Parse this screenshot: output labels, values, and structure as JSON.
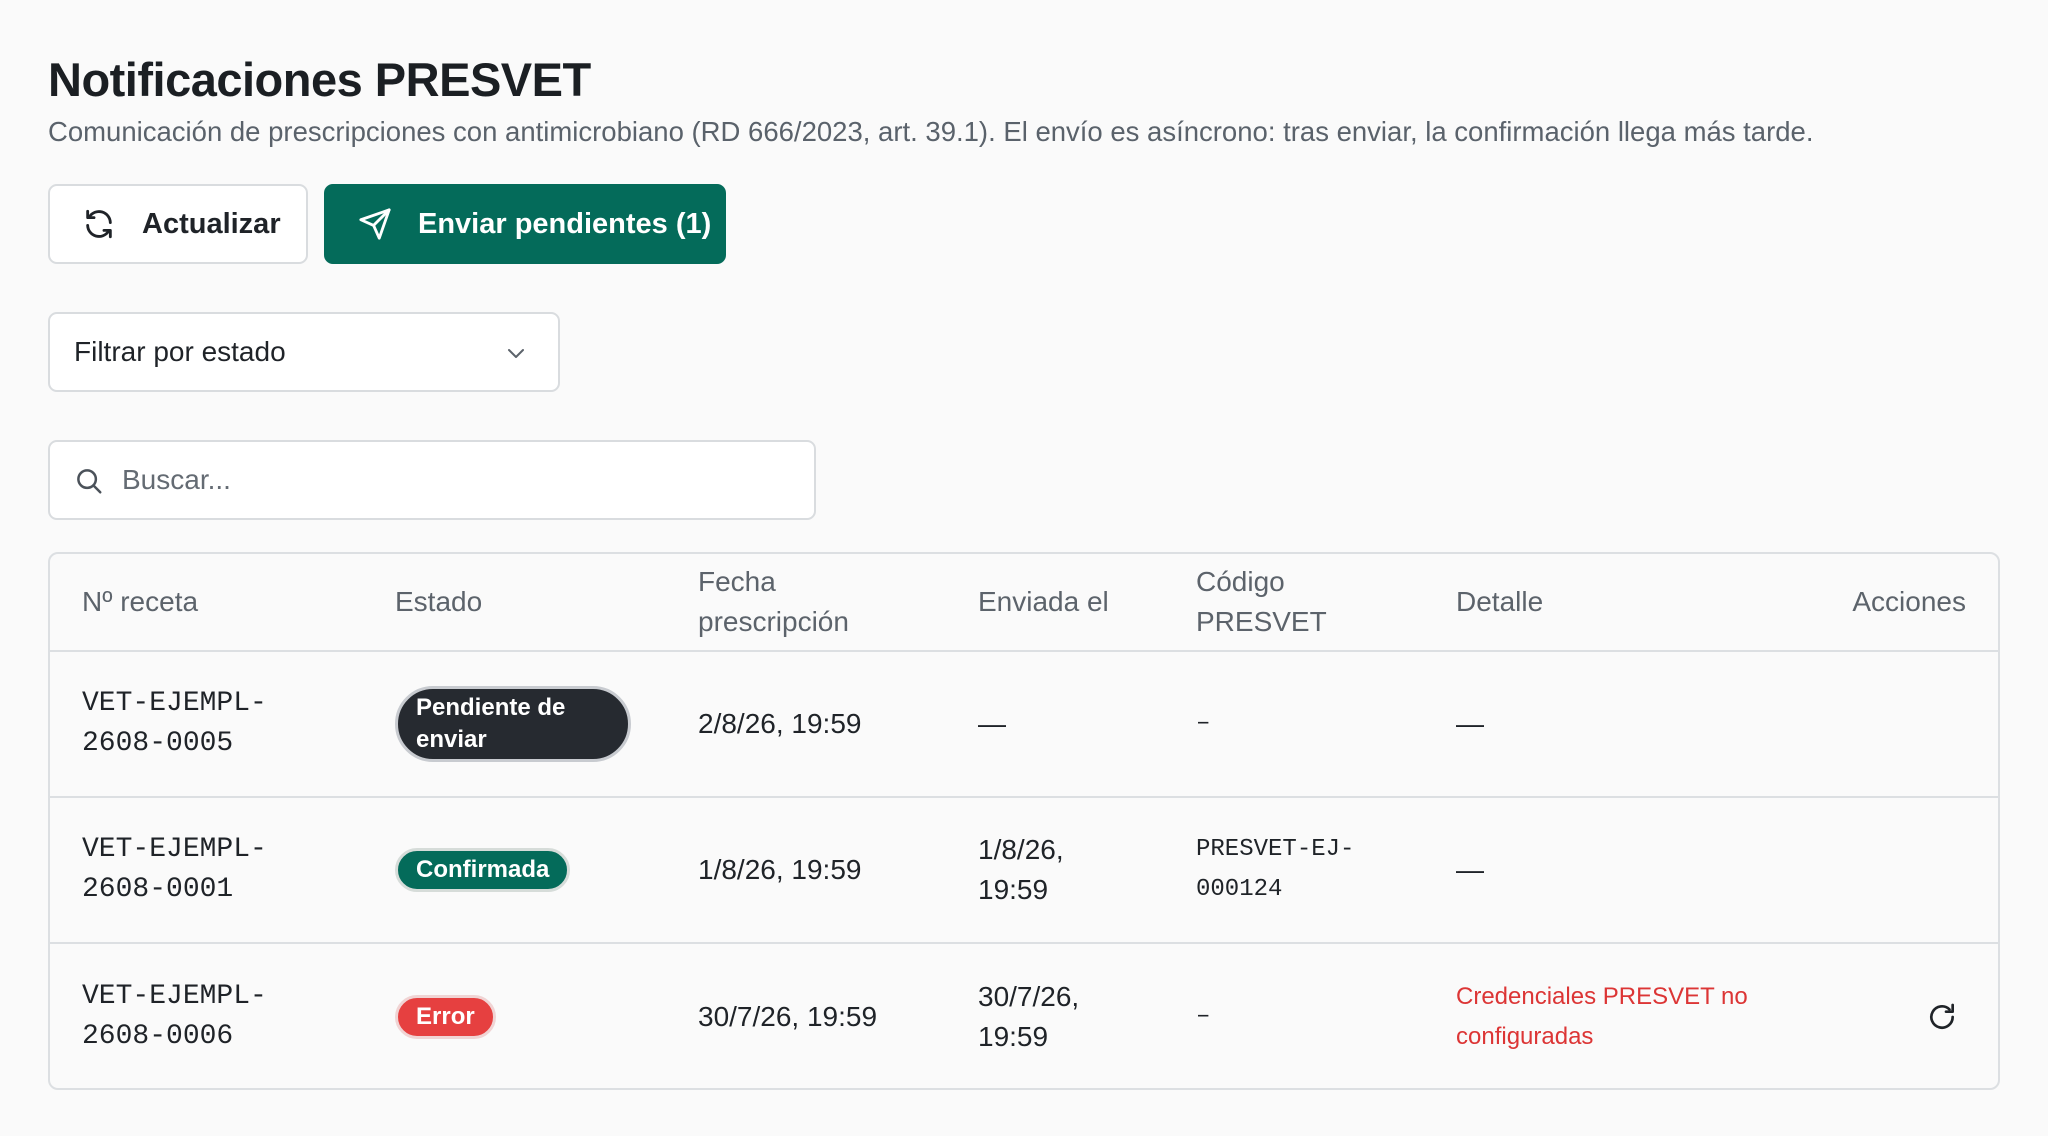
{
  "header": {
    "title": "Notificaciones PRESVET",
    "subtitle": "Comunicación de prescripciones con antimicrobiano (RD 666/2023, art. 39.1). El envío es asíncrono: tras enviar, la confirmación llega más tarde."
  },
  "toolbar": {
    "refresh_label": "Actualizar",
    "refresh_icon": "refresh-icon",
    "send_label": "Enviar pendientes (1)",
    "send_icon": "paper-plane-icon",
    "accent_color": "#046b5a"
  },
  "filter": {
    "placeholder": "Filtrar por estado",
    "icon": "chevron-down-icon"
  },
  "search": {
    "placeholder": "Buscar...",
    "value": "",
    "icon": "search-icon"
  },
  "table": {
    "columns": {
      "receta": "Nº receta",
      "estado": "Estado",
      "fecha_1": "Fecha",
      "fecha_2": "prescripción",
      "enviada": "Enviada el",
      "codigo_1": "Código",
      "codigo_2": "PRESVET",
      "detalle": "Detalle",
      "acciones": "Acciones"
    },
    "rows": [
      {
        "receta_1": "VET-EJEMPL-",
        "receta_2": "2608-0005",
        "estado_1": "Pendiente de",
        "estado_2": "enviar",
        "estado_color": "#262a30",
        "fecha": "2/8/26, 19:59",
        "enviada_1": "—",
        "enviada_2": "",
        "codigo_1": "–",
        "codigo_2": "",
        "detalle_1": "—",
        "detalle_2": ""
      },
      {
        "receta_1": "VET-EJEMPL-",
        "receta_2": "2608-0001",
        "estado": "Confirmada",
        "estado_color": "#046b5a",
        "fecha": "1/8/26, 19:59",
        "enviada_1": "1/8/26,",
        "enviada_2": "19:59",
        "codigo_1": "PRESVET-EJ-",
        "codigo_2": "000124",
        "detalle_1": "—",
        "detalle_2": ""
      },
      {
        "receta_1": "VET-EJEMPL-",
        "receta_2": "2608-0006",
        "estado": "Error",
        "estado_color": "#e64040",
        "fecha": "30/7/26, 19:59",
        "enviada_1": "30/7/26,",
        "enviada_2": "19:59",
        "codigo_1": "–",
        "codigo_2": "",
        "detalle_1": "Credenciales PRESVET no",
        "detalle_2": "configuradas",
        "detalle_color": "#dc3535",
        "action_icon": "retry-icon"
      }
    ]
  }
}
